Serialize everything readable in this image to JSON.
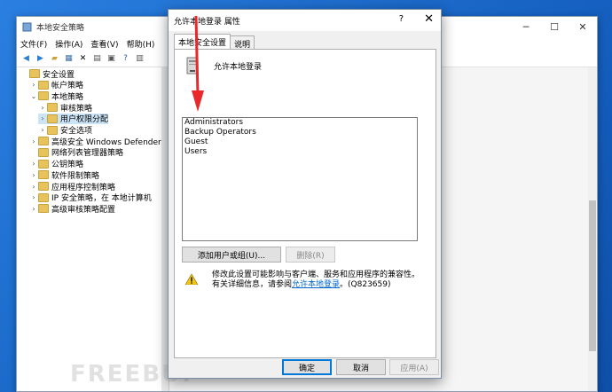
{
  "mmc": {
    "title": "本地安全策略",
    "menu": [
      "文件(F)",
      "操作(A)",
      "查看(V)",
      "帮助(H)"
    ],
    "tree": [
      {
        "label": "安全设置",
        "depth": 0,
        "exp": ""
      },
      {
        "label": "帐户策略",
        "depth": 1,
        "exp": "›"
      },
      {
        "label": "本地策略",
        "depth": 1,
        "exp": "⌄"
      },
      {
        "label": "审核策略",
        "depth": 2,
        "exp": "›"
      },
      {
        "label": "用户权限分配",
        "depth": 2,
        "exp": "›",
        "selected": true
      },
      {
        "label": "安全选项",
        "depth": 2,
        "exp": "›"
      },
      {
        "label": "高级安全 Windows Defender 防火墙",
        "depth": 1,
        "exp": "›"
      },
      {
        "label": "网络列表管理器策略",
        "depth": 1,
        "exp": ""
      },
      {
        "label": "公钥策略",
        "depth": 1,
        "exp": "›"
      },
      {
        "label": "软件限制策略",
        "depth": 1,
        "exp": "›"
      },
      {
        "label": "应用程序控制策略",
        "depth": 1,
        "exp": "›"
      },
      {
        "label": "IP 安全策略，在 本地计算机",
        "depth": 1,
        "exp": "›"
      },
      {
        "label": "高级审核策略配置",
        "depth": 1,
        "exp": "›"
      }
    ],
    "watermark": "FREEBUF"
  },
  "dialog": {
    "title": "允许本地登录 属性",
    "help": "?",
    "close": "✕",
    "tabs": [
      "本地安全设置",
      "说明"
    ],
    "policy_name": "允许本地登录",
    "members": [
      "Administrators",
      "Backup Operators",
      "Guest",
      "Users"
    ],
    "add_button": "添加用户或组(U)...",
    "remove_button": "删除(R)",
    "warning_line1": "修改此设置可能影响与客户端、服务和应用程序的兼容性。",
    "warning_line2_prefix": "有关详细信息，请参阅",
    "warning_link": "允许本地登录",
    "warning_line2_suffix": "。(Q823659)",
    "ok": "确定",
    "cancel": "取消",
    "apply": "应用(A)"
  },
  "colors": {
    "accent": "#0078d7",
    "arrow": "#e8282a"
  }
}
